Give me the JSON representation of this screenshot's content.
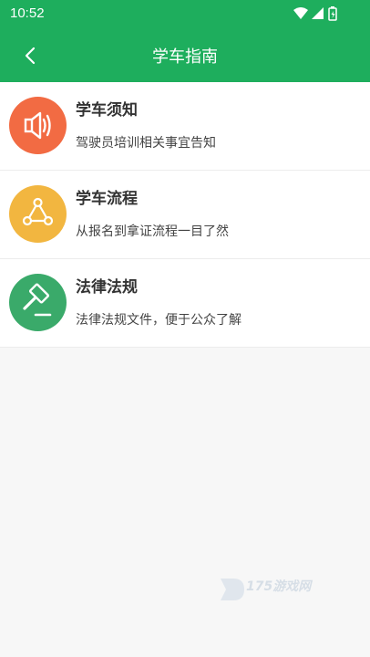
{
  "status_bar": {
    "time": "10:52",
    "icons": [
      "wifi-icon",
      "signal-icon",
      "battery-icon"
    ],
    "background_color": "#1eae5d"
  },
  "header": {
    "title": "学车指南",
    "back_icon": "chevron-left-icon",
    "background_color": "#1eae5d"
  },
  "items": [
    {
      "title": "学车须知",
      "desc": "驾驶员培训相关事宜告知",
      "icon": "speaker-icon",
      "color": "#f26b43"
    },
    {
      "title": "学车流程",
      "desc": "从报名到拿证流程一目了然",
      "icon": "process-icon",
      "color": "#f2b640"
    },
    {
      "title": "法律法规",
      "desc": "法律法规文件，便于公众了解",
      "icon": "gavel-icon",
      "color": "#3aaa6a"
    }
  ],
  "watermark": {
    "text": "175游戏网"
  }
}
